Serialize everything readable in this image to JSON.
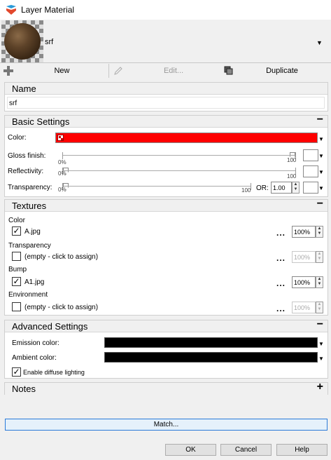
{
  "window": {
    "title": "Layer Material"
  },
  "header": {
    "material_name": "srf"
  },
  "toolbar": {
    "new_label": "New",
    "edit_label": "Edit...",
    "duplicate_label": "Duplicate"
  },
  "name_panel": {
    "title": "Name",
    "value": "srf"
  },
  "basic": {
    "title": "Basic Settings",
    "color_label": "Color:",
    "color_hex": "#ff0000",
    "gloss_label": "Gloss finish:",
    "reflectivity_label": "Reflectivity:",
    "transparency_label": "Transparency:",
    "tick_min": "0%",
    "tick_max": "100",
    "gloss_value": 100,
    "reflectivity_value": 0,
    "transparency_value": 0,
    "or_label": "OR:",
    "or_value": "1.00"
  },
  "textures": {
    "title": "Textures",
    "color": {
      "label": "Color",
      "file": "A.jpg",
      "checked": true,
      "percent": "100%"
    },
    "transparency": {
      "label": "Transparency",
      "file": "(empty - click to assign)",
      "checked": false,
      "percent": "100%"
    },
    "bump": {
      "label": "Bump",
      "file": "A1.jpg",
      "checked": true,
      "percent": "100%"
    },
    "environment": {
      "label": "Environment",
      "file": "(empty - click to assign)",
      "checked": false,
      "percent": "100%"
    },
    "dots": "...",
    "check_glyph": "✓"
  },
  "advanced": {
    "title": "Advanced Settings",
    "emission_label": "Emission color:",
    "emission_hex": "#000000",
    "ambient_label": "Ambient color:",
    "ambient_hex": "#000000",
    "diffuse_label": "Enable diffuse lighting",
    "diffuse_checked": true
  },
  "notes": {
    "title": "Notes"
  },
  "footer": {
    "match_label": "Match...",
    "ok_label": "OK",
    "cancel_label": "Cancel",
    "help_label": "Help"
  },
  "glyphs": {
    "collapse": "−",
    "expand": "+",
    "caret": "▼",
    "spin_up": "▲",
    "spin_down": "▼"
  }
}
